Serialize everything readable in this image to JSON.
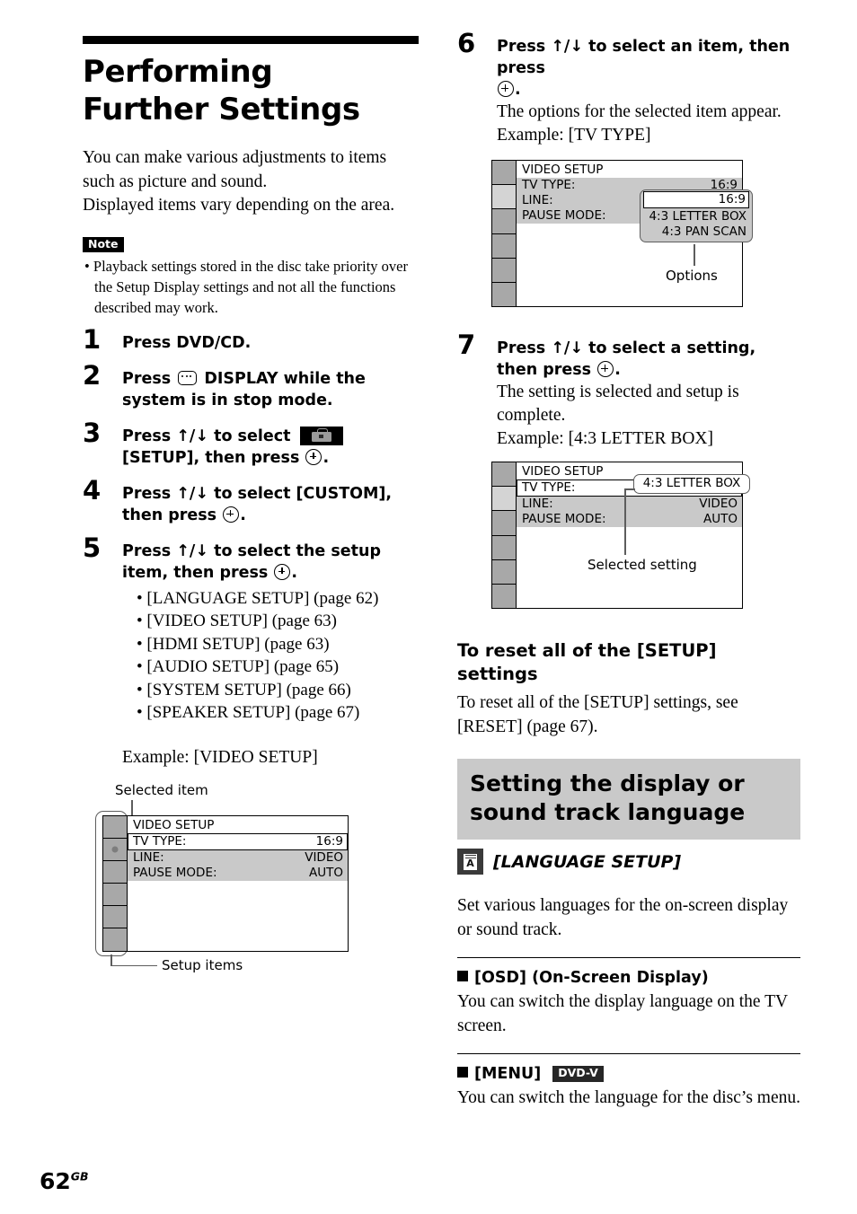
{
  "page": {
    "number": "62",
    "region": "GB"
  },
  "left": {
    "title": "Performing Further Settings",
    "intro": [
      "You can make various adjustments to items such as picture and sound.",
      "Displayed items vary depending on the area."
    ],
    "note": {
      "label": "Note",
      "items": [
        "Playback settings stored in the disc take priority over the Setup Display settings and not all the functions described may work."
      ]
    },
    "steps": [
      {
        "num": "1",
        "head_pre": "Press DVD/CD.",
        "icons": []
      },
      {
        "num": "2",
        "head_a": "Press",
        "icon": "display-icon",
        "head_b": "DISPLAY while the system is in stop mode."
      },
      {
        "num": "3",
        "head_a": "Press",
        "arrows": "↑/↓",
        "head_b": "to select",
        "icon": "setup-toolbox-icon",
        "head_c": "[SETUP], then press",
        "icon2": "enter-icon",
        "head_d": "."
      },
      {
        "num": "4",
        "head_a": "Press",
        "arrows": "↑/↓",
        "head_b": "to select [CUSTOM], then press",
        "icon2": "enter-icon",
        "head_d": "."
      },
      {
        "num": "5",
        "head_a": "Press",
        "arrows": "↑/↓",
        "head_b": "to select the setup item, then press",
        "icon2": "enter-icon",
        "head_d": "."
      }
    ],
    "step5_bullets": [
      "[LANGUAGE SETUP] (page 62)",
      "[VIDEO SETUP] (page 63)",
      "[HDMI SETUP] (page 63)",
      "[AUDIO SETUP] (page 65)",
      "[SYSTEM SETUP] (page 66)",
      "[SPEAKER SETUP] (page 67)"
    ],
    "example_label": "Example: [VIDEO SETUP]",
    "diagram": {
      "label_top": "Selected item",
      "label_bottom": "Setup items",
      "title": "VIDEO SETUP",
      "rows": [
        {
          "name": "TV TYPE:",
          "value": "16:9",
          "state": "highlighted"
        },
        {
          "name": "LINE:",
          "value": "VIDEO",
          "state": "gray"
        },
        {
          "name": "PAUSE MODE:",
          "value": "AUTO",
          "state": "gray"
        }
      ],
      "rail_cells": 6,
      "rail_marked_index": 1
    }
  },
  "right": {
    "step6": {
      "num": "6",
      "head_a": "Press",
      "arrows": "↑/↓",
      "head_b": "to select an item, then press",
      "head_c": ".",
      "sub1": "The options for the selected item appear.",
      "sub2": "Example: [TV TYPE]"
    },
    "diagram6": {
      "title": "VIDEO SETUP",
      "rows": [
        {
          "name": "TV TYPE:",
          "value": "16:9",
          "state": "gray"
        },
        {
          "name": "LINE:",
          "value": "",
          "state": "gray"
        },
        {
          "name": "PAUSE MODE:",
          "value": "",
          "state": "gray"
        }
      ],
      "options": [
        "16:9",
        "4:3 LETTER BOX",
        "4:3 PAN SCAN"
      ],
      "options_selected": "16:9",
      "callout_label": "Options",
      "rail_cells": 6,
      "rail_selected_index": 1
    },
    "step7": {
      "num": "7",
      "head_a": "Press",
      "arrows": "↑/↓",
      "head_b": "to select a setting, then press",
      "head_c": ".",
      "sub1": "The setting is selected and setup is complete.",
      "sub2": "Example: [4:3 LETTER BOX]"
    },
    "diagram7": {
      "title": "VIDEO SETUP",
      "rows": [
        {
          "name": "TV TYPE:",
          "value": "",
          "state": "highlighted"
        },
        {
          "name": "LINE:",
          "value": "VIDEO",
          "state": "gray"
        },
        {
          "name": "PAUSE MODE:",
          "value": "AUTO",
          "state": "gray"
        }
      ],
      "callout_value": "4:3 LETTER BOX",
      "callout_label": "Selected setting",
      "rail_cells": 6,
      "rail_selected_index": 1
    },
    "reset": {
      "heading": "To reset all of the [SETUP] settings",
      "body": "To reset all of the [SETUP] settings, see [RESET] (page 67)."
    },
    "band_heading": "Setting the display or sound track language",
    "lang_setup_title": "[LANGUAGE SETUP]",
    "lang_setup_body": "Set various languages for the on-screen display or sound track.",
    "sections": [
      {
        "heading": "[OSD] (On-Screen Display)",
        "badge": "",
        "body": "You can switch the display language on the TV screen."
      },
      {
        "heading": "[MENU]",
        "badge": "DVD-V",
        "body": "You can switch the language for the disc’s menu."
      }
    ]
  }
}
